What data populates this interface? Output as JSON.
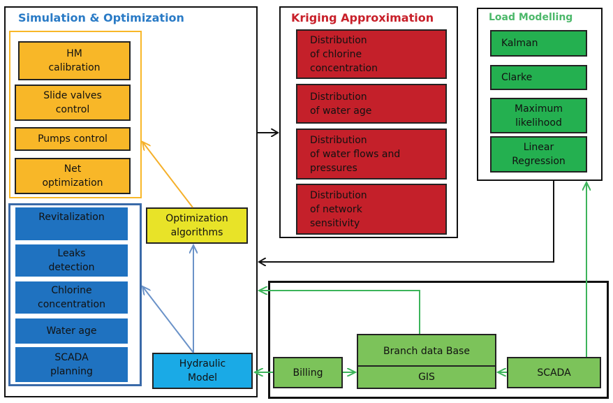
{
  "colors": {
    "simulation_title": "#2a7bc6",
    "kriging_title": "#c8202a",
    "load_title": "#4cb86a",
    "orange_fill": "#f8b728",
    "blue_fill": "#1f72c0",
    "red_fill": "#c4202a",
    "green_fill": "#24b050",
    "light_green_fill": "#7cc35a",
    "yellow_fill": "#e8e328",
    "cyan_fill": "#1aaae6"
  },
  "simulation": {
    "title": "Simulation & Optimization",
    "optimization_tasks": [
      {
        "lines": [
          "HM",
          "calibration"
        ]
      },
      {
        "lines": [
          "Slide valves",
          "control"
        ]
      },
      {
        "lines": [
          "Pumps control"
        ]
      },
      {
        "lines": [
          "Net",
          "optimization"
        ]
      }
    ],
    "simulation_tasks": [
      {
        "lines": [
          "Revitalization"
        ]
      },
      {
        "lines": [
          "Leaks",
          "detection"
        ]
      },
      {
        "lines": [
          "Chlorine",
          "concentration"
        ]
      },
      {
        "lines": [
          "Water age"
        ]
      },
      {
        "lines": [
          "SCADA",
          "planning"
        ]
      }
    ],
    "optimization_algorithms": [
      "Optimization",
      "algorithms"
    ],
    "hydraulic_model": [
      "Hydraulic",
      "Model"
    ]
  },
  "kriging": {
    "title": "Kriging Approximation",
    "items": [
      {
        "lines": [
          "Distribution",
          "of chlorine",
          "concentration"
        ]
      },
      {
        "lines": [
          "Distribution",
          "of water age"
        ]
      },
      {
        "lines": [
          "Distribution",
          "of water flows and",
          "pressures"
        ]
      },
      {
        "lines": [
          "Distribution",
          "of network",
          "sensitivity"
        ]
      }
    ]
  },
  "load": {
    "title": "Load Modelling",
    "items": [
      {
        "lines": [
          "Kalman"
        ]
      },
      {
        "lines": [
          "Clarke"
        ]
      },
      {
        "lines": [
          "Maximum",
          "likelihood"
        ]
      },
      {
        "lines": [
          "Linear",
          "Regression"
        ]
      }
    ]
  },
  "data_sources": {
    "billing": "Billing",
    "branch_db": "Branch data Base",
    "gis": "GIS",
    "scada": "SCADA"
  }
}
